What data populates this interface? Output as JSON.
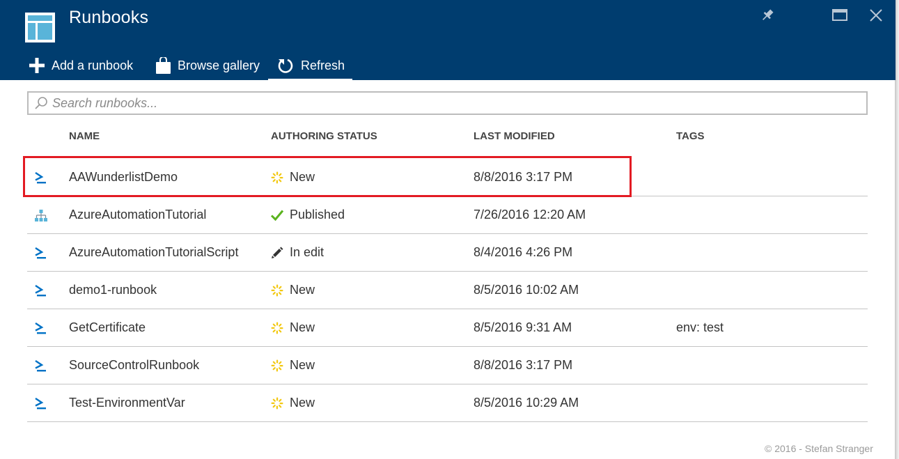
{
  "header": {
    "title": "Runbooks",
    "bg_color": "#003d6f"
  },
  "toolbar": {
    "add_label": "Add a runbook",
    "browse_label": "Browse gallery",
    "refresh_label": "Refresh"
  },
  "search": {
    "placeholder": "Search runbooks..."
  },
  "table": {
    "columns": [
      "NAME",
      "AUTHORING STATUS",
      "LAST MODIFIED",
      "TAGS"
    ],
    "rows": [
      {
        "type_icon": "powershell-icon",
        "name": "AAWunderlistDemo",
        "status_icon": "new-status-icon",
        "status": "New",
        "modified": "8/8/2016 3:17 PM",
        "tags": ""
      },
      {
        "type_icon": "graphical-runbook-icon",
        "name": "AzureAutomationTutorial",
        "status_icon": "published-check-icon",
        "status": "Published",
        "modified": "7/26/2016 12:20 AM",
        "tags": ""
      },
      {
        "type_icon": "powershell-icon",
        "name": "AzureAutomationTutorialScript",
        "status_icon": "edit-pencil-icon",
        "status": "In edit",
        "modified": "8/4/2016 4:26 PM",
        "tags": ""
      },
      {
        "type_icon": "powershell-icon",
        "name": "demo1-runbook",
        "status_icon": "new-status-icon",
        "status": "New",
        "modified": "8/5/2016 10:02 AM",
        "tags": ""
      },
      {
        "type_icon": "powershell-icon",
        "name": "GetCertificate",
        "status_icon": "new-status-icon",
        "status": "New",
        "modified": "8/5/2016 9:31 AM",
        "tags": "env: test"
      },
      {
        "type_icon": "powershell-icon",
        "name": "SourceControlRunbook",
        "status_icon": "new-status-icon",
        "status": "New",
        "modified": "8/8/2016 3:17 PM",
        "tags": ""
      },
      {
        "type_icon": "powershell-icon",
        "name": "Test-EnvironmentVar",
        "status_icon": "new-status-icon",
        "status": "New",
        "modified": "8/5/2016 10:29 AM",
        "tags": ""
      }
    ]
  },
  "colors": {
    "highlight_border": "#e31b23",
    "new_status": "#f2c811",
    "published_status": "#5ab31e",
    "powershell_icon": "#0072c6"
  },
  "footer": {
    "copyright": "© 2016 - Stefan Stranger"
  }
}
